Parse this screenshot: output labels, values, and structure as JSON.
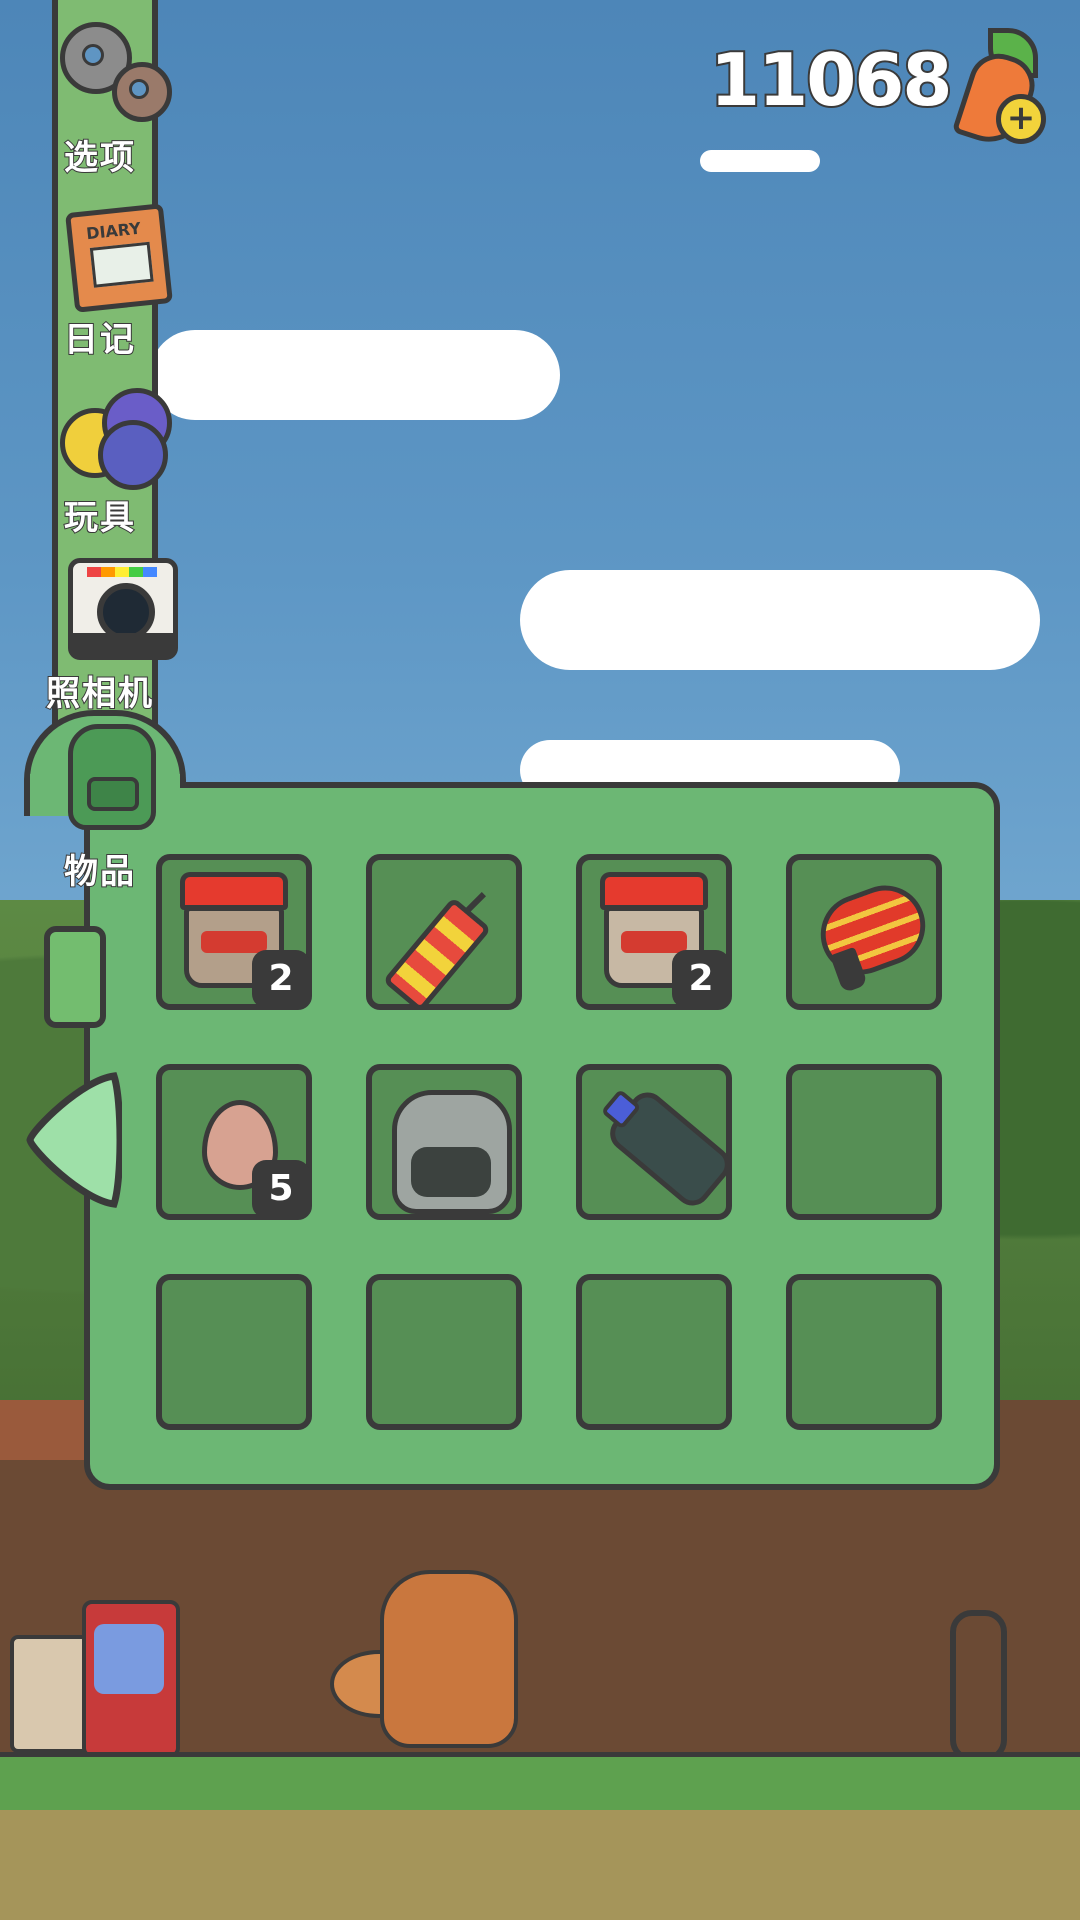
{
  "hud": {
    "carrot_count": "11068",
    "carrot_icon": "carrot-plus-icon"
  },
  "sidebar": {
    "items": [
      {
        "label": "选项",
        "icon": "gear-icon"
      },
      {
        "label": "日记",
        "icon": "diary-icon"
      },
      {
        "label": "玩具",
        "icon": "toy-balls-icon"
      },
      {
        "label": "照相机",
        "icon": "camera-icon"
      },
      {
        "label": "物品",
        "icon": "backpack-icon"
      }
    ],
    "diary_cover_text": "DIARY"
  },
  "inventory": {
    "selected_tab": "物品",
    "slots": [
      {
        "item": "red-lid-jar",
        "count": "2"
      },
      {
        "item": "firework-rocket",
        "count": ""
      },
      {
        "item": "red-lid-jar",
        "count": "2"
      },
      {
        "item": "paper-lantern",
        "count": ""
      },
      {
        "item": "egg",
        "count": "5"
      },
      {
        "item": "trash-bag",
        "count": ""
      },
      {
        "item": "plastic-bottle",
        "count": ""
      },
      {
        "item": "empty",
        "count": ""
      },
      {
        "item": "empty",
        "count": ""
      },
      {
        "item": "empty",
        "count": ""
      },
      {
        "item": "empty",
        "count": ""
      },
      {
        "item": "empty",
        "count": ""
      }
    ]
  },
  "colors": {
    "panel": "#6cb774",
    "slot": "#568f55",
    "outline": "#3a3a3a",
    "sky": "#5e97c5"
  }
}
